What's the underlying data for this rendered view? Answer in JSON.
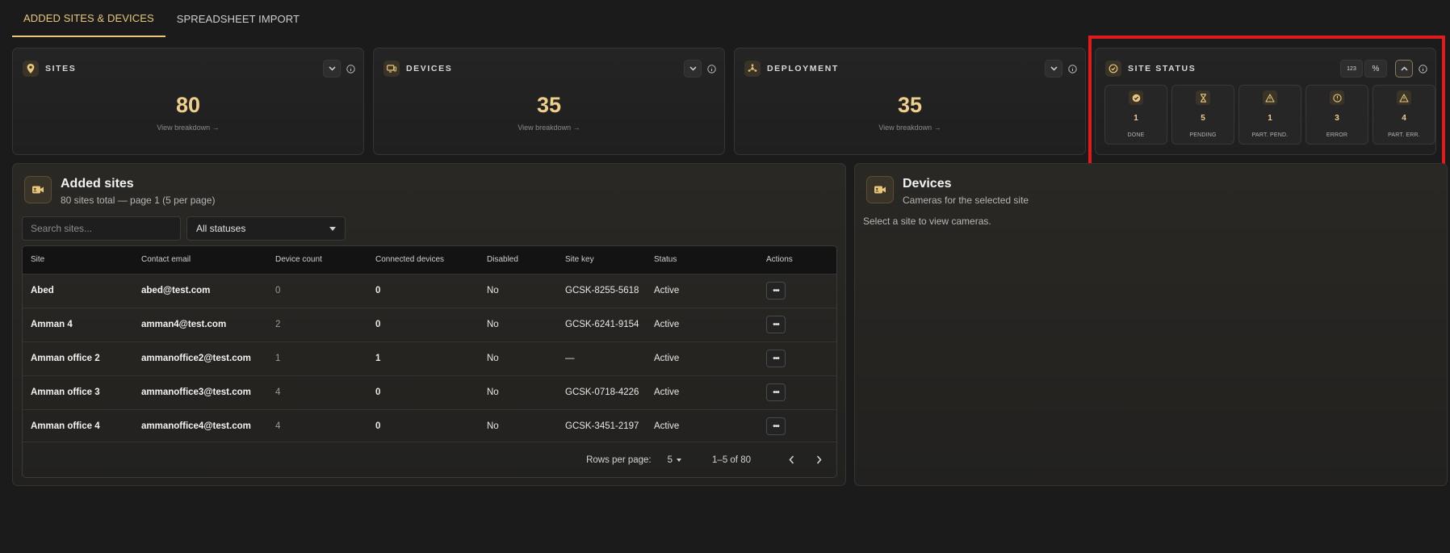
{
  "tabs": [
    {
      "label": "ADDED SITES & DEVICES",
      "active": true
    },
    {
      "label": "SPREADSHEET IMPORT",
      "active": false
    }
  ],
  "cards": {
    "sites": {
      "title": "SITES",
      "value": "80",
      "link": "View breakdown →"
    },
    "devices": {
      "title": "DEVICES",
      "value": "35",
      "link": "View breakdown →"
    },
    "deployment": {
      "title": "DEPLOYMENT",
      "value": "35",
      "link": "View breakdown →"
    }
  },
  "site_status": {
    "title": "SITE STATUS",
    "toggle_count_label": "123",
    "toggle_percent_label": "%",
    "tiles": [
      {
        "count": "1",
        "label": "DONE",
        "icon": "check-circle-icon"
      },
      {
        "count": "5",
        "label": "PENDING",
        "icon": "hourglass-icon"
      },
      {
        "count": "1",
        "label": "PART. PEND.",
        "icon": "warning-icon"
      },
      {
        "count": "3",
        "label": "ERROR",
        "icon": "alert-circle-icon"
      },
      {
        "count": "4",
        "label": "PART. ERR.",
        "icon": "warning-icon"
      }
    ]
  },
  "sites_panel": {
    "title": "Added sites",
    "subtitle": "80 sites total — page 1 (5 per page)",
    "search_placeholder": "Search sites...",
    "status_filter": "All statuses",
    "columns": [
      "Site",
      "Contact email",
      "Device count",
      "Connected devices",
      "Disabled",
      "Site key",
      "Status",
      "Actions"
    ],
    "rows": [
      {
        "site": "Abed",
        "email": "abed@test.com",
        "device_count": "0",
        "connected": "0",
        "disabled": "No",
        "key": "GCSK-8255-5618",
        "status": "Active"
      },
      {
        "site": "Amman 4",
        "email": "amman4@test.com",
        "device_count": "2",
        "connected": "0",
        "disabled": "No",
        "key": "GCSK-6241-9154",
        "status": "Active"
      },
      {
        "site": "Amman office 2",
        "email": "ammanoffice2@test.com",
        "device_count": "1",
        "connected": "1",
        "disabled": "No",
        "key": "—",
        "status": "Active"
      },
      {
        "site": "Amman office 3",
        "email": "ammanoffice3@test.com",
        "device_count": "4",
        "connected": "0",
        "disabled": "No",
        "key": "GCSK-0718-4226",
        "status": "Active"
      },
      {
        "site": "Amman office 4",
        "email": "ammanoffice4@test.com",
        "device_count": "4",
        "connected": "0",
        "disabled": "No",
        "key": "GCSK-3451-2197",
        "status": "Active"
      }
    ],
    "pager": {
      "rows_per_page_label": "Rows per page:",
      "rows_per_page": "5",
      "range": "1–5 of 80"
    }
  },
  "devices_panel": {
    "title": "Devices",
    "subtitle": "Cameras for the selected site",
    "empty_text": "Select a site to view cameras."
  },
  "colors": {
    "accent": "#e8c77a",
    "value": "#efcf8a",
    "highlight": "#e01b1b",
    "background": "#1b1b1c"
  }
}
